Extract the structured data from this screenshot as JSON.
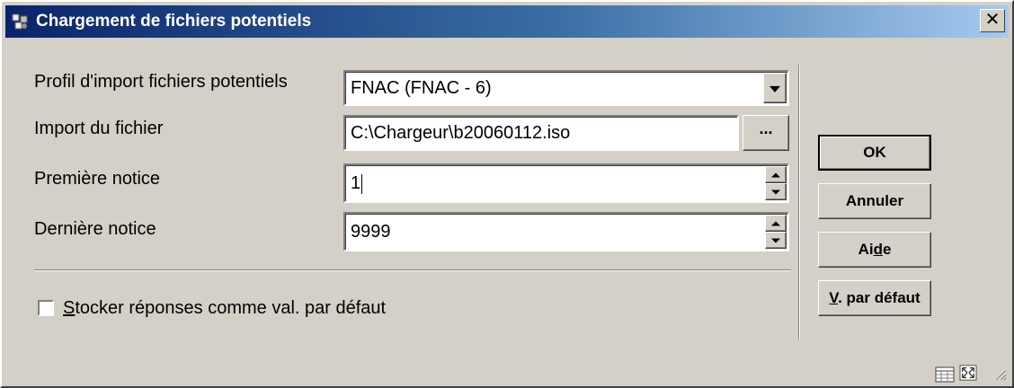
{
  "window": {
    "title": "Chargement de fichiers potentiels",
    "close_glyph": "✕"
  },
  "form": {
    "profile": {
      "label": "Profil d'import fichiers potentiels",
      "value": "FNAC (FNAC - 6)"
    },
    "file": {
      "label": "Import du fichier",
      "value": "C:\\Chargeur\\b20060112.iso",
      "browse_label": "..."
    },
    "first_record": {
      "label": "Première notice",
      "value": "1"
    },
    "last_record": {
      "label": "Dernière notice",
      "value": "9999"
    },
    "store_defaults": {
      "label_mnemonic": "S",
      "label_rest": "tocker réponses comme val. par défaut",
      "checked": false
    }
  },
  "buttons": {
    "ok": "OK",
    "cancel": "Annuler",
    "help_pre": "Ai",
    "help_mnemonic": "d",
    "help_post": "e",
    "defaults_mnemonic": "V",
    "defaults_rest": ". par défaut"
  },
  "icons": {
    "app": "app-icon",
    "status_left": "grid-icon",
    "status_right": "resize-window-icon"
  },
  "colors": {
    "title_start": "#0a246a",
    "title_end": "#a6caf0",
    "face": "#d4d0c8"
  }
}
